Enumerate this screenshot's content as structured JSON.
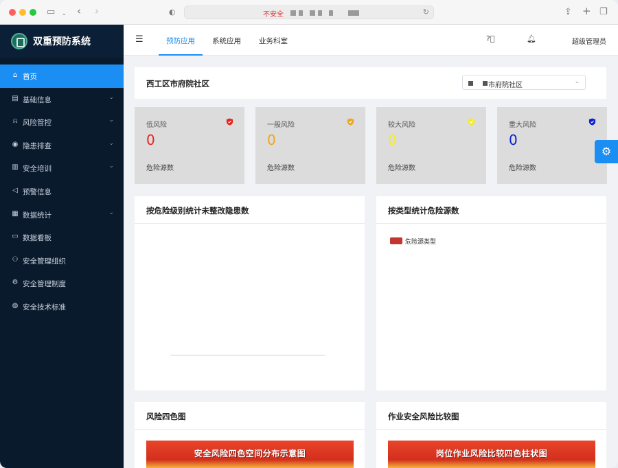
{
  "browser": {
    "security_label": "不安全"
  },
  "sidebar": {
    "app_name": "双重预防系统",
    "items": [
      {
        "label": "首页",
        "icon": "home-icon",
        "active": true,
        "expandable": false
      },
      {
        "label": "基础信息",
        "icon": "document-icon",
        "active": false,
        "expandable": true
      },
      {
        "label": "风险管控",
        "icon": "alarm-icon",
        "active": false,
        "expandable": true
      },
      {
        "label": "隐患排查",
        "icon": "eye-icon",
        "active": false,
        "expandable": true
      },
      {
        "label": "安全培训",
        "icon": "file-icon",
        "active": false,
        "expandable": true
      },
      {
        "label": "预警信息",
        "icon": "speaker-icon",
        "active": false,
        "expandable": false
      },
      {
        "label": "数据统计",
        "icon": "chart-icon",
        "active": false,
        "expandable": true
      },
      {
        "label": "数据看板",
        "icon": "monitor-icon",
        "active": false,
        "expandable": false
      },
      {
        "label": "安全管理组织",
        "icon": "people-icon",
        "active": false,
        "expandable": false
      },
      {
        "label": "安全管理制度",
        "icon": "gear-icon",
        "active": false,
        "expandable": false
      },
      {
        "label": "安全技术标准",
        "icon": "globe-icon",
        "active": false,
        "expandable": false
      }
    ]
  },
  "topnav": {
    "tabs": [
      "预防应用",
      "系统应用",
      "业务科室"
    ],
    "active_tab": "预防应用",
    "user": "超级管理员"
  },
  "header_card": {
    "title": "西工区市府院社区",
    "select_value": "市府院社区"
  },
  "risk_cards": [
    {
      "label": "低风险",
      "value": "0",
      "sub": "危险源数",
      "color": "#e8231c"
    },
    {
      "label": "一般风险",
      "value": "0",
      "sub": "危险源数",
      "color": "#f0a519"
    },
    {
      "label": "较大风险",
      "value": "0",
      "sub": "危险源数",
      "color": "#f5ee1a"
    },
    {
      "label": "重大风险",
      "value": "0",
      "sub": "危险源数",
      "color": "#0d1fcf"
    }
  ],
  "panels": {
    "hazard_level_title": "按危险级别统计未整改隐患数",
    "hazard_type_title": "按类型统计危险源数",
    "hazard_type_legend": "危险源类型",
    "four_color_title": "风险四色图",
    "four_color_banner": "安全风险四色空间分布示意图",
    "compare_title": "作业安全风险比较图",
    "compare_banner": "岗位作业风险比较四色柱状图"
  },
  "colors": {
    "primary": "#1a8ef3",
    "sidebar_bg": "#091a2d",
    "legend": "#c23531"
  }
}
